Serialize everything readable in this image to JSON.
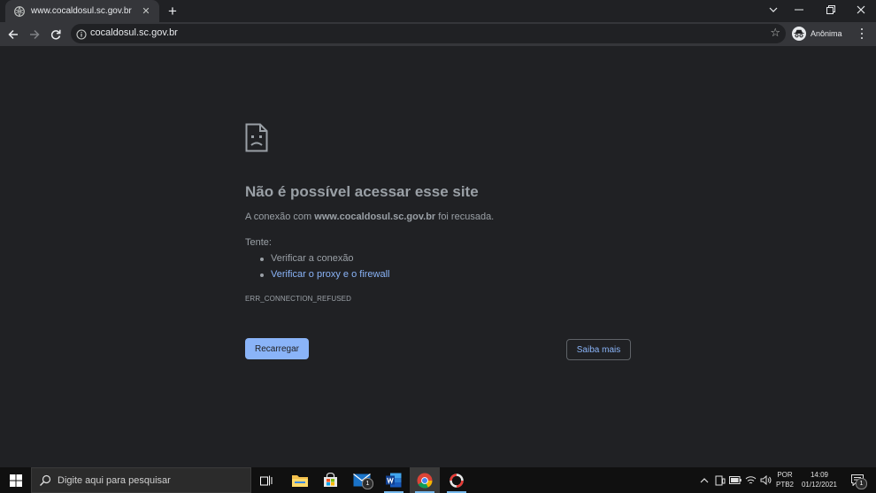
{
  "browser": {
    "tab_title": "www.cocaldosul.sc.gov.br",
    "tab_close": "✕",
    "new_tab": "+",
    "url": "cocaldosul.sc.gov.br",
    "profile_label": "Anônima"
  },
  "error_page": {
    "title": "Não é possível acessar esse site",
    "desc_prefix": "A conexão com ",
    "desc_host": "www.cocaldosul.sc.gov.br",
    "desc_suffix": " foi recusada.",
    "try_label": "Tente:",
    "suggestions": [
      "Verificar a conexão",
      "Verificar o proxy e o firewall"
    ],
    "error_code": "ERR_CONNECTION_REFUSED",
    "reload_button": "Recarregar",
    "more_button": "Saiba mais"
  },
  "taskbar": {
    "search_placeholder": "Digite aqui para pesquisar",
    "mail_badge": "1",
    "notif_badge": "1",
    "lang_line1": "POR",
    "lang_line2": "PTB2",
    "time": "14:09",
    "date": "01/12/2021"
  },
  "colors": {
    "page_bg": "#202124",
    "toolbar_bg": "#35363a",
    "link": "#8ab4f8",
    "text_secondary": "#9aa0a6"
  }
}
